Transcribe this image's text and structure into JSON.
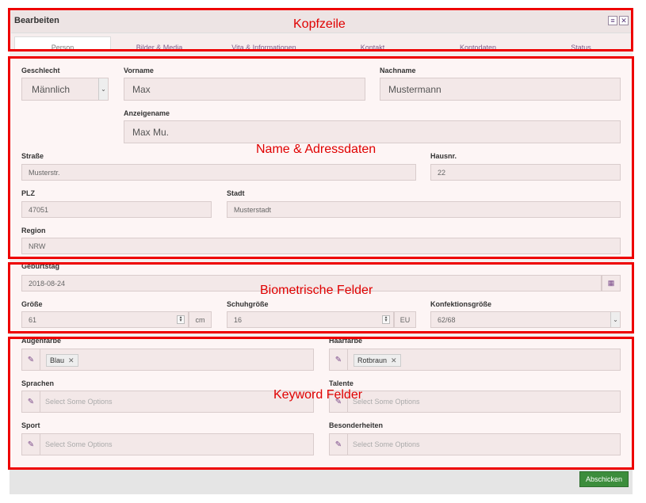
{
  "header": {
    "title": "Bearbeiten",
    "menu_icon": "list-icon",
    "close_icon": "close-icon"
  },
  "tabs": [
    "Person",
    "Bilder & Media",
    "Vita & Informationen",
    "Kontakt",
    "Kontodaten",
    "Status"
  ],
  "annotations": {
    "kopfzeile": "Kopfzeile",
    "name_adress": "Name & Adressdaten",
    "biometrisch": "Biometrische Felder",
    "keyword": "Keyword Felder"
  },
  "name_section": {
    "geschlecht_label": "Geschlecht",
    "geschlecht_value": "Männlich",
    "vorname_label": "Vorname",
    "vorname_value": "Max",
    "nachname_label": "Nachname",
    "nachname_value": "Mustermann",
    "anzeigename_label": "Anzeigename",
    "anzeigename_value": "Max Mu.",
    "strasse_label": "Straße",
    "strasse_value": "Musterstr.",
    "hausnr_label": "Hausnr.",
    "hausnr_value": "22",
    "plz_label": "PLZ",
    "plz_value": "47051",
    "stadt_label": "Stadt",
    "stadt_value": "Musterstadt",
    "region_label": "Region",
    "region_value": "NRW"
  },
  "bio_section": {
    "geburtstag_label": "Geburtstag",
    "geburtstag_value": "2018-08-24",
    "groesse_label": "Größe",
    "groesse_value": "61",
    "groesse_unit": "cm",
    "schuh_label": "Schuhgröße",
    "schuh_value": "16",
    "schuh_unit": "EU",
    "konf_label": "Konfektionsgröße",
    "konf_value": "62/68"
  },
  "keyword_section": {
    "augen_label": "Augenfarbe",
    "augen_tag": "Blau",
    "haar_label": "Haarfarbe",
    "haar_tag": "Rotbraun",
    "sprachen_label": "Sprachen",
    "talente_label": "Talente",
    "sport_label": "Sport",
    "besonder_label": "Besonderheiten",
    "placeholder": "Select Some Options"
  },
  "footer": {
    "submit_label": "Abschicken"
  }
}
